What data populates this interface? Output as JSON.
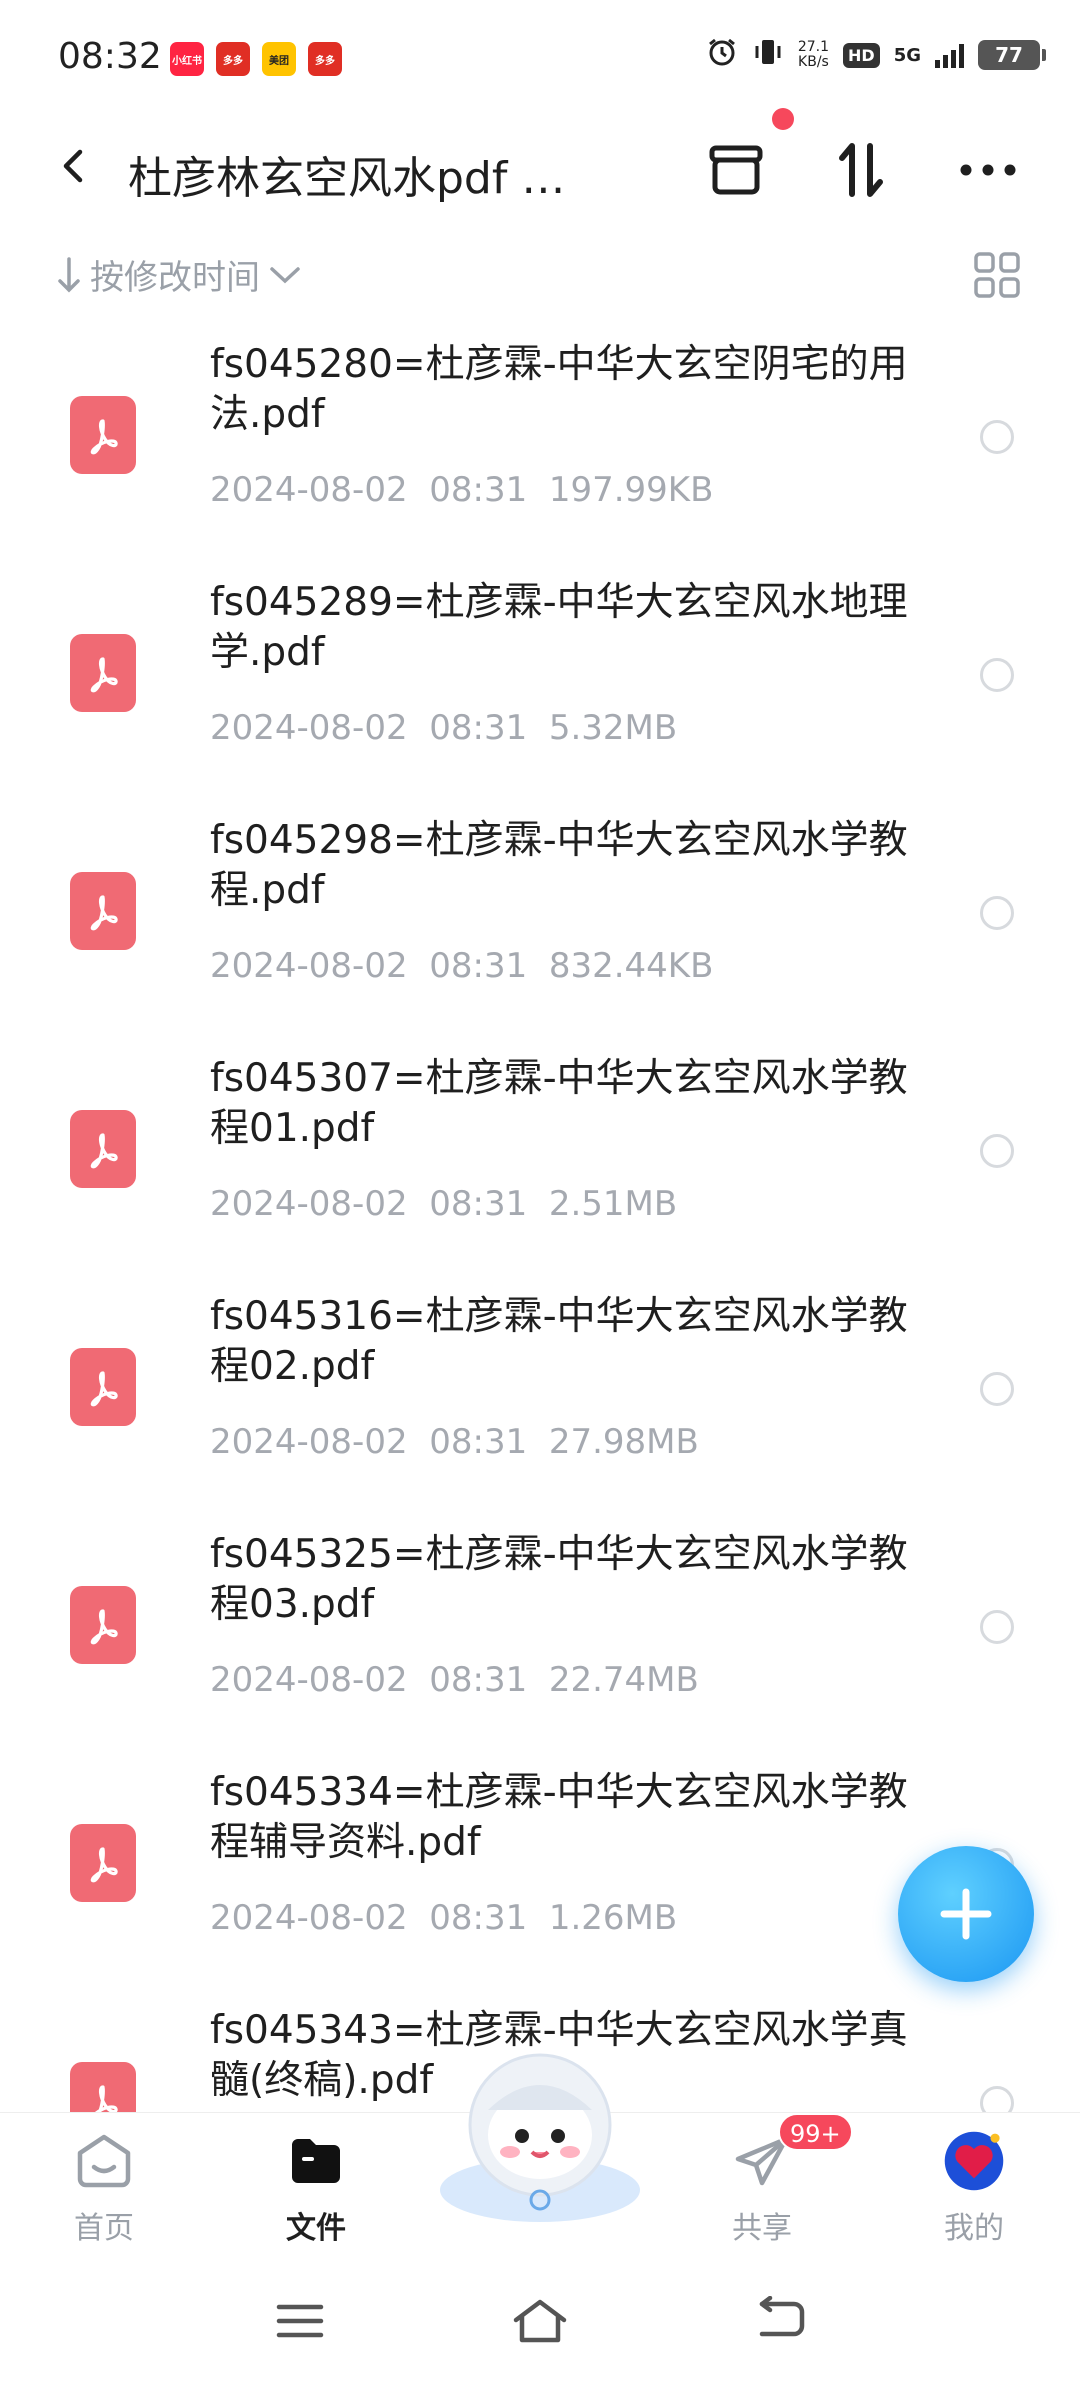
{
  "status_bar": {
    "time": "08:32",
    "app_badges": [
      {
        "label": "小红书",
        "color": "#ff2442"
      },
      {
        "label": "多多",
        "color": "#e02e24"
      },
      {
        "label": "美团",
        "color": "#ffc300"
      },
      {
        "label": "多多",
        "color": "#e02e24"
      }
    ],
    "net_speed_value": "27.1",
    "net_speed_unit": "KB/s",
    "hd": "HD",
    "network": "5G",
    "battery": "77"
  },
  "header": {
    "title": "杜彦林玄空风水pdf …",
    "icons": {
      "back": "back-arrow-icon",
      "box": "archive-box-icon",
      "sort": "sort-icon",
      "more": "more-icon"
    },
    "notification_dot_color": "#f6485c"
  },
  "sort": {
    "label": "按修改时间",
    "view_toggle": "grid-view-icon"
  },
  "files": [
    {
      "name": "fs045280=杜彦霖-中华大玄空阴宅的用法.pdf",
      "date": "2024-08-02",
      "time": "08:31",
      "size": "197.99KB"
    },
    {
      "name": "fs045289=杜彦霖-中华大玄空风水地理学.pdf",
      "date": "2024-08-02",
      "time": "08:31",
      "size": "5.32MB"
    },
    {
      "name": "fs045298=杜彦霖-中华大玄空风水学教程.pdf",
      "date": "2024-08-02",
      "time": "08:31",
      "size": "832.44KB"
    },
    {
      "name": "fs045307=杜彦霖-中华大玄空风水学教程01.pdf",
      "date": "2024-08-02",
      "time": "08:31",
      "size": "2.51MB"
    },
    {
      "name": "fs045316=杜彦霖-中华大玄空风水学教程02.pdf",
      "date": "2024-08-02",
      "time": "08:31",
      "size": "27.98MB"
    },
    {
      "name": "fs045325=杜彦霖-中华大玄空风水学教程03.pdf",
      "date": "2024-08-02",
      "time": "08:31",
      "size": "22.74MB"
    },
    {
      "name": "fs045334=杜彦霖-中华大玄空风水学教程辅导资料.pdf",
      "date": "2024-08-02",
      "time": "08:31",
      "size": "1.26MB"
    },
    {
      "name": "fs045343=杜彦霖-中华大玄空风水学真髓(终稿).pdf",
      "date": "",
      "time": "",
      "size": ""
    }
  ],
  "fab": {
    "icon": "plus-icon"
  },
  "bottom_nav": {
    "home": "首页",
    "files": "文件",
    "share": "共享",
    "share_badge": "99+",
    "mine": "我的"
  },
  "colors": {
    "accent": "#1a96f2",
    "pdf_icon": "#f06a74",
    "badge": "#f6485c",
    "secondary_text": "#a5a9b0"
  }
}
